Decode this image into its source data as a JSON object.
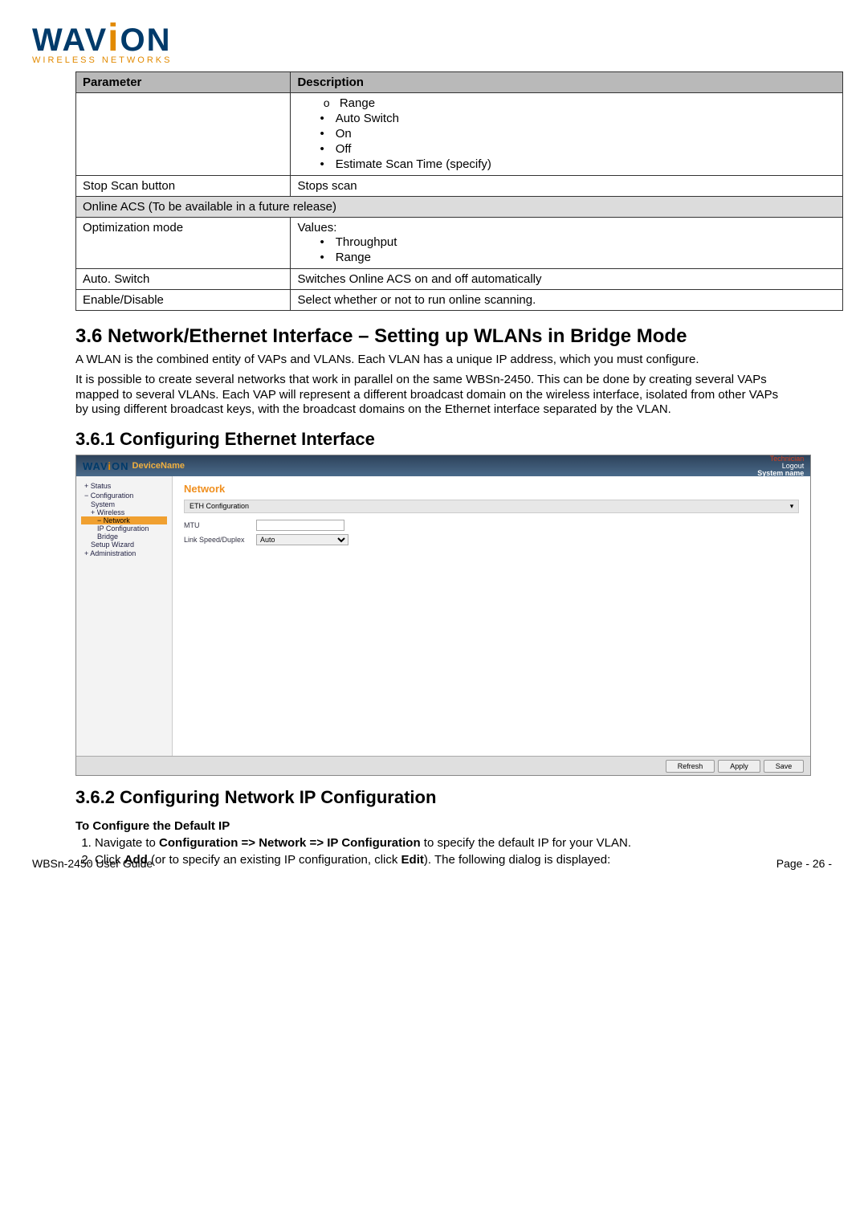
{
  "logo": {
    "brand": "WAV",
    "brand_i": "i",
    "brand_end": "ON",
    "tagline": "WIRELESS NETWORKS"
  },
  "table": {
    "headers": {
      "param": "Parameter",
      "desc": "Description"
    },
    "row1_desc_sub": "Range",
    "row1_desc_items": [
      "Auto Switch",
      "On",
      "Off",
      "Estimate Scan Time (specify)"
    ],
    "row2": {
      "param": "Stop Scan button",
      "desc": "Stops scan"
    },
    "section": "Online ACS (To be available in a future release)",
    "row3": {
      "param": "Optimization mode",
      "desc_lead": "Values:",
      "items": [
        "Throughput",
        "Range"
      ]
    },
    "row4": {
      "param": "Auto. Switch",
      "desc": "Switches Online ACS on and off automatically"
    },
    "row5": {
      "param": "Enable/Disable",
      "desc": "Select whether or not to run online scanning."
    }
  },
  "section_3_6": {
    "title": "3.6   Network/Ethernet Interface – Setting up WLANs in Bridge Mode",
    "para1": "A WLAN is the combined entity of VAPs and VLANs. Each VLAN has a unique IP address, which you must configure.",
    "para2": "It is possible to create several networks that work in parallel on the same WBSn-2450. This can be done by creating several VAPs mapped to several VLANs. Each VAP will represent a different broadcast domain on the wireless interface, isolated from other VAPs by using different broadcast keys, with the broadcast domains on the Ethernet interface separated by the VLAN."
  },
  "section_3_6_1": {
    "title": "3.6.1      Configuring Ethernet Interface"
  },
  "screenshot": {
    "device_name": "DeviceName",
    "user": "Technician",
    "logout": "Logout",
    "system": "System name",
    "sidebar": {
      "status": "Status",
      "config": "Configuration",
      "system_item": "System",
      "wireless": "Wireless",
      "network": "Network",
      "ipconfig": "IP Configuration",
      "bridge": "Bridge",
      "setup": "Setup Wizard",
      "admin": "Administration"
    },
    "main": {
      "title": "Network",
      "panel": "ETH Configuration",
      "mtu": "MTU",
      "link": "Link Speed/Duplex",
      "link_value": "Auto"
    },
    "buttons": {
      "refresh": "Refresh",
      "apply": "Apply",
      "save": "Save"
    }
  },
  "section_3_6_2": {
    "title": "3.6.2      Configuring Network IP Configuration",
    "proc_title": "To Configure the Default IP",
    "step1_a": "Navigate to ",
    "step1_b": "Configuration => Network => IP Configuration",
    "step1_c": " to specify the default IP for your VLAN.",
    "step2_a": "Click ",
    "step2_b": "Add",
    "step2_c": " (or to specify an existing IP configuration, click ",
    "step2_d": "Edit",
    "step2_e": "). The following dialog is displayed:"
  },
  "footer": {
    "left": "WBSn-2450 User Guide",
    "right": "Page - 26 -"
  }
}
